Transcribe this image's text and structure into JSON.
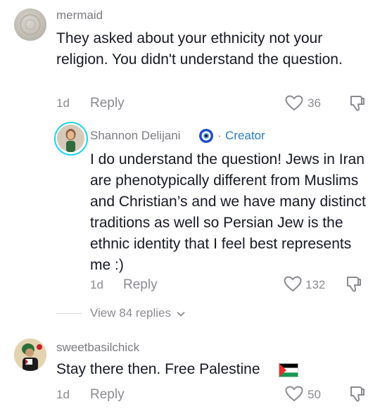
{
  "comments": [
    {
      "username": "mermaid",
      "text": "They asked about your ethnicity not your religion. You didn't understand the question.",
      "time": "1d",
      "reply_label": "Reply",
      "likes": "36"
    },
    {
      "username": "Shannon Delijani",
      "badge_separator": "·",
      "badge_label": "Creator",
      "text": "I do understand the question! Jews in Iran are phenotypically different from Muslims and Christian’s and we have many distinct traditions as well so Persian Jew is the ethnic identity that I feel best represents me :)",
      "time": "1d",
      "reply_label": "Reply",
      "likes": "132"
    },
    {
      "username": "sweetbasilchick",
      "text": "Stay there then. Free Palestine",
      "time": "1d",
      "reply_label": "Reply",
      "likes": "50"
    }
  ],
  "view_replies_label": "View 84 replies",
  "colors": {
    "text": "#161823",
    "muted": "#8a8b91",
    "creator_blue": "#2b7bbd",
    "avatar_ring": "#20d5ec"
  }
}
